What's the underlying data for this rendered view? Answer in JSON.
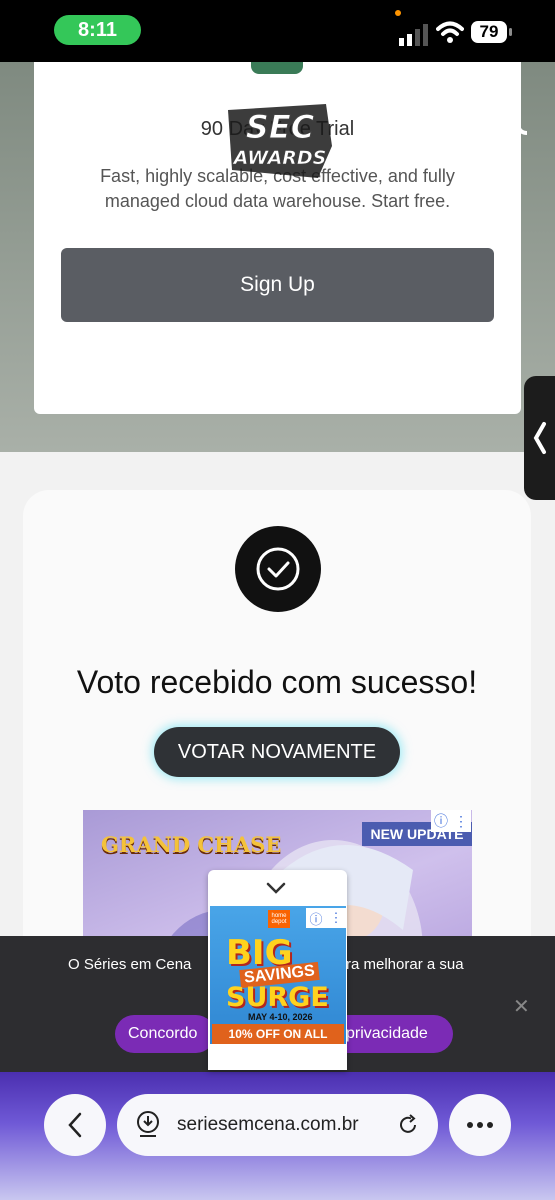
{
  "status_bar": {
    "time": "8:11",
    "battery": "79"
  },
  "header": {
    "logo_text": "SEC AWARDS",
    "social": [
      "x-icon",
      "instagram-icon",
      "tiktok-icon"
    ]
  },
  "top_ad": {
    "title": "90 Day Free Trial",
    "description": "Fast, highly scalable, cost effective, and fully managed cloud data warehouse. Start free.",
    "button_label": "Sign Up"
  },
  "vote": {
    "message": "Voto recebido com sucesso!",
    "button_label": "VOTAR NOVAMENTE"
  },
  "game_ad": {
    "logo": "GRAND CHASE",
    "badge": "NEW UPDATE"
  },
  "cookie": {
    "text_left": "O Séries em Cena",
    "text_right": "ra melhorar a sua",
    "accept_label": "Concordo",
    "privacy_label": "privacidade",
    "close": "✕"
  },
  "floating_ad": {
    "big": "BIG",
    "savings": "SAVINGS",
    "surge": "SURGE",
    "dates": "MAY 4-10, 2026",
    "offer": "10% OFF ON ALL",
    "brand": "home depot"
  },
  "browser": {
    "url": "seriesemcena.com.br"
  }
}
